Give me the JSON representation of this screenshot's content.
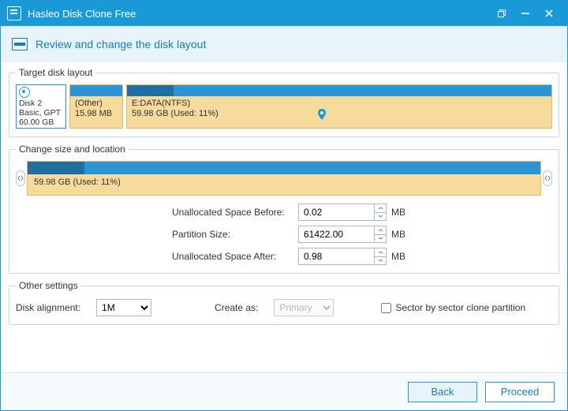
{
  "window": {
    "title": "Hasleo Disk Clone Free"
  },
  "subheader": {
    "text": "Review and change the disk layout"
  },
  "sections": {
    "target": {
      "legend": "Target disk layout",
      "disk": {
        "name": "Disk 2",
        "type": "Basic, GPT",
        "size": "60.00 GB"
      },
      "parts": {
        "other": {
          "label": "(Other)",
          "size": "15.98 MB"
        },
        "e": {
          "label": "E:DATA(NTFS)",
          "size": "59.98 GB (Used: 11%)"
        }
      }
    },
    "resize": {
      "legend": "Change size and location",
      "bar_label": "59.98 GB (Used: 11%)",
      "rows": {
        "before": {
          "label": "Unallocated Space Before:",
          "value": "0.02",
          "unit": "MB"
        },
        "size": {
          "label": "Partition Size:",
          "value": "61422.00",
          "unit": "MB"
        },
        "after": {
          "label": "Unallocated Space After:",
          "value": "0.98",
          "unit": "MB"
        }
      }
    },
    "other": {
      "legend": "Other settings",
      "alignment_label": "Disk alignment:",
      "alignment_value": "1M",
      "create_as_label": "Create as:",
      "create_as_value": "Primary",
      "sector_label": "Sector by sector clone partition",
      "sector_checked": false
    }
  },
  "footer": {
    "back": "Back",
    "proceed": "Proceed"
  }
}
